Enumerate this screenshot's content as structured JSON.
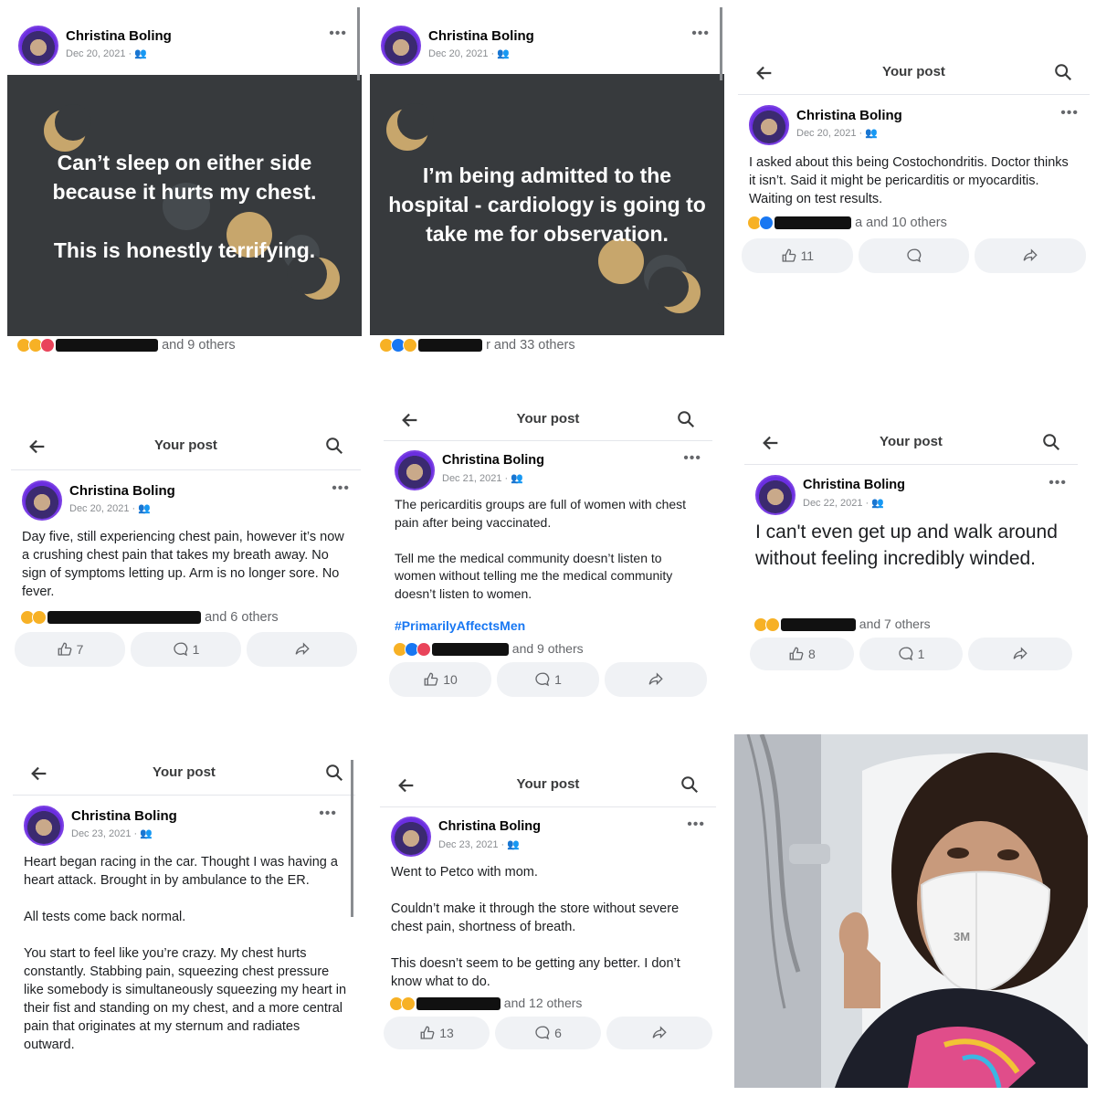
{
  "header": {
    "your_post": "Your post"
  },
  "author": "Christina Boling",
  "posts": [
    {
      "date": "Dec 20, 2021",
      "card_text": "Can’t sleep on either side because it hurts my chest.\n\nThis is honestly terrifying.",
      "reactions": "and 9 others"
    },
    {
      "date": "Dec 20, 2021",
      "card_text": "I’m being admitted to the hospital - cardiology is going to take me for observation.",
      "reactions": "r and 33 others"
    },
    {
      "date": "Dec 20, 2021",
      "text": "I asked about this being Costochondritis.  Doctor thinks it isn’t.  Said it might be pericarditis or myocarditis.  Waiting on test results.",
      "reactions": "a and 10 others",
      "likes": "11"
    },
    {
      "date": "Dec 20, 2021",
      "text": "Day five, still experiencing chest pain, however it’s now a crushing chest pain that takes my breath away.  No sign of symptoms letting up.  Arm is no longer sore.  No fever.",
      "reactions": "and 6 others",
      "likes": "7",
      "comments": "1"
    },
    {
      "date": "Dec 21, 2021",
      "text": "The pericarditis groups are full of women with chest pain after being vaccinated.\n\nTell me the medical community doesn’t listen to women without telling me the medical community doesn’t listen to women.",
      "hashtag": "#PrimarilyAffectsMen",
      "reactions": "and 9 others",
      "likes": "10",
      "comments": "1"
    },
    {
      "date": "Dec 22, 2021",
      "text": "I can't even get up and walk around without feeling incredibly winded.",
      "reactions": "and 7 others",
      "likes": "8",
      "comments": "1"
    },
    {
      "date": "Dec 23, 2021",
      "text": "Heart began racing in the car.  Thought I was having a heart attack.  Brought in by ambulance to the ER.\n\nAll tests come back normal.\n\nYou start to feel like you’re crazy.  My chest hurts constantly. Stabbing pain, squeezing chest pressure like somebody is simultaneously squeezing my heart in their fist and standing on my chest, and a more central pain that originates at my sternum and radiates outward."
    },
    {
      "date": "Dec 23, 2021",
      "text": "Went to Petco with mom.\n\nCouldn’t make it through the store without severe chest pain, shortness of breath.\n\nThis doesn’t seem to be getting any better.  I don’t know what to do.",
      "reactions": "and 12 others",
      "likes": "13",
      "comments": "6"
    }
  ],
  "photo": {
    "mask_label": "3M"
  }
}
